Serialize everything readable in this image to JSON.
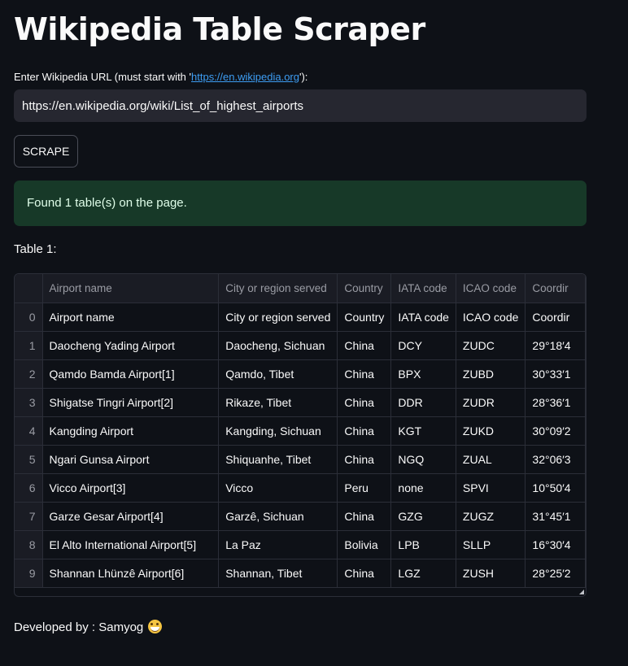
{
  "app": {
    "title": "Wikipedia Table Scraper"
  },
  "url_field": {
    "label_prefix": "Enter Wikipedia URL (must start with '",
    "label_link": "https://en.wikipedia.org",
    "label_suffix": "'):",
    "value": "https://en.wikipedia.org/wiki/List_of_highest_airports"
  },
  "scrape_button": {
    "label": "SCRAPE"
  },
  "status": {
    "message": "Found 1 table(s) on the page.",
    "color": "#173928"
  },
  "table_section": {
    "label": "Table 1:"
  },
  "table": {
    "columns": [
      "",
      "Airport name",
      "City or region served",
      "Country",
      "IATA code",
      "ICAO code",
      "Coordir"
    ],
    "rows": [
      [
        "0",
        "Airport name",
        "City or region served",
        "Country",
        "IATA code",
        "ICAO code",
        "Coordir"
      ],
      [
        "1",
        "Daocheng Yading Airport",
        "Daocheng, Sichuan",
        "China",
        "DCY",
        "ZUDC",
        "29°18′4"
      ],
      [
        "2",
        "Qamdo Bamda Airport[1]",
        "Qamdo, Tibet",
        "China",
        "BPX",
        "ZUBD",
        "30°33′1"
      ],
      [
        "3",
        "Shigatse Tingri Airport[2]",
        "Rikaze, Tibet",
        "China",
        "DDR",
        "ZUDR",
        "28°36′1"
      ],
      [
        "4",
        "Kangding Airport",
        "Kangding, Sichuan",
        "China",
        "KGT",
        "ZUKD",
        "30°09′2"
      ],
      [
        "5",
        "Ngari Gunsa Airport",
        "Shiquanhe, Tibet",
        "China",
        "NGQ",
        "ZUAL",
        "32°06′3"
      ],
      [
        "6",
        "Vicco Airport[3]",
        "Vicco",
        "Peru",
        "none",
        "SPVI",
        "10°50′4"
      ],
      [
        "7",
        "Garze Gesar Airport[4]",
        "Garzê, Sichuan",
        "China",
        "GZG",
        "ZUGZ",
        "31°45′1"
      ],
      [
        "8",
        "El Alto International Airport[5]",
        "La Paz",
        "Bolivia",
        "LPB",
        "SLLP",
        "16°30′4"
      ],
      [
        "9",
        "Shannan Lhünzê Airport[6]",
        "Shannan, Tibet",
        "China",
        "LGZ",
        "ZUSH",
        "28°25′2"
      ]
    ]
  },
  "footer": {
    "text": "Developed by : Samyog",
    "emoji_icon": "grinning-face-icon"
  }
}
